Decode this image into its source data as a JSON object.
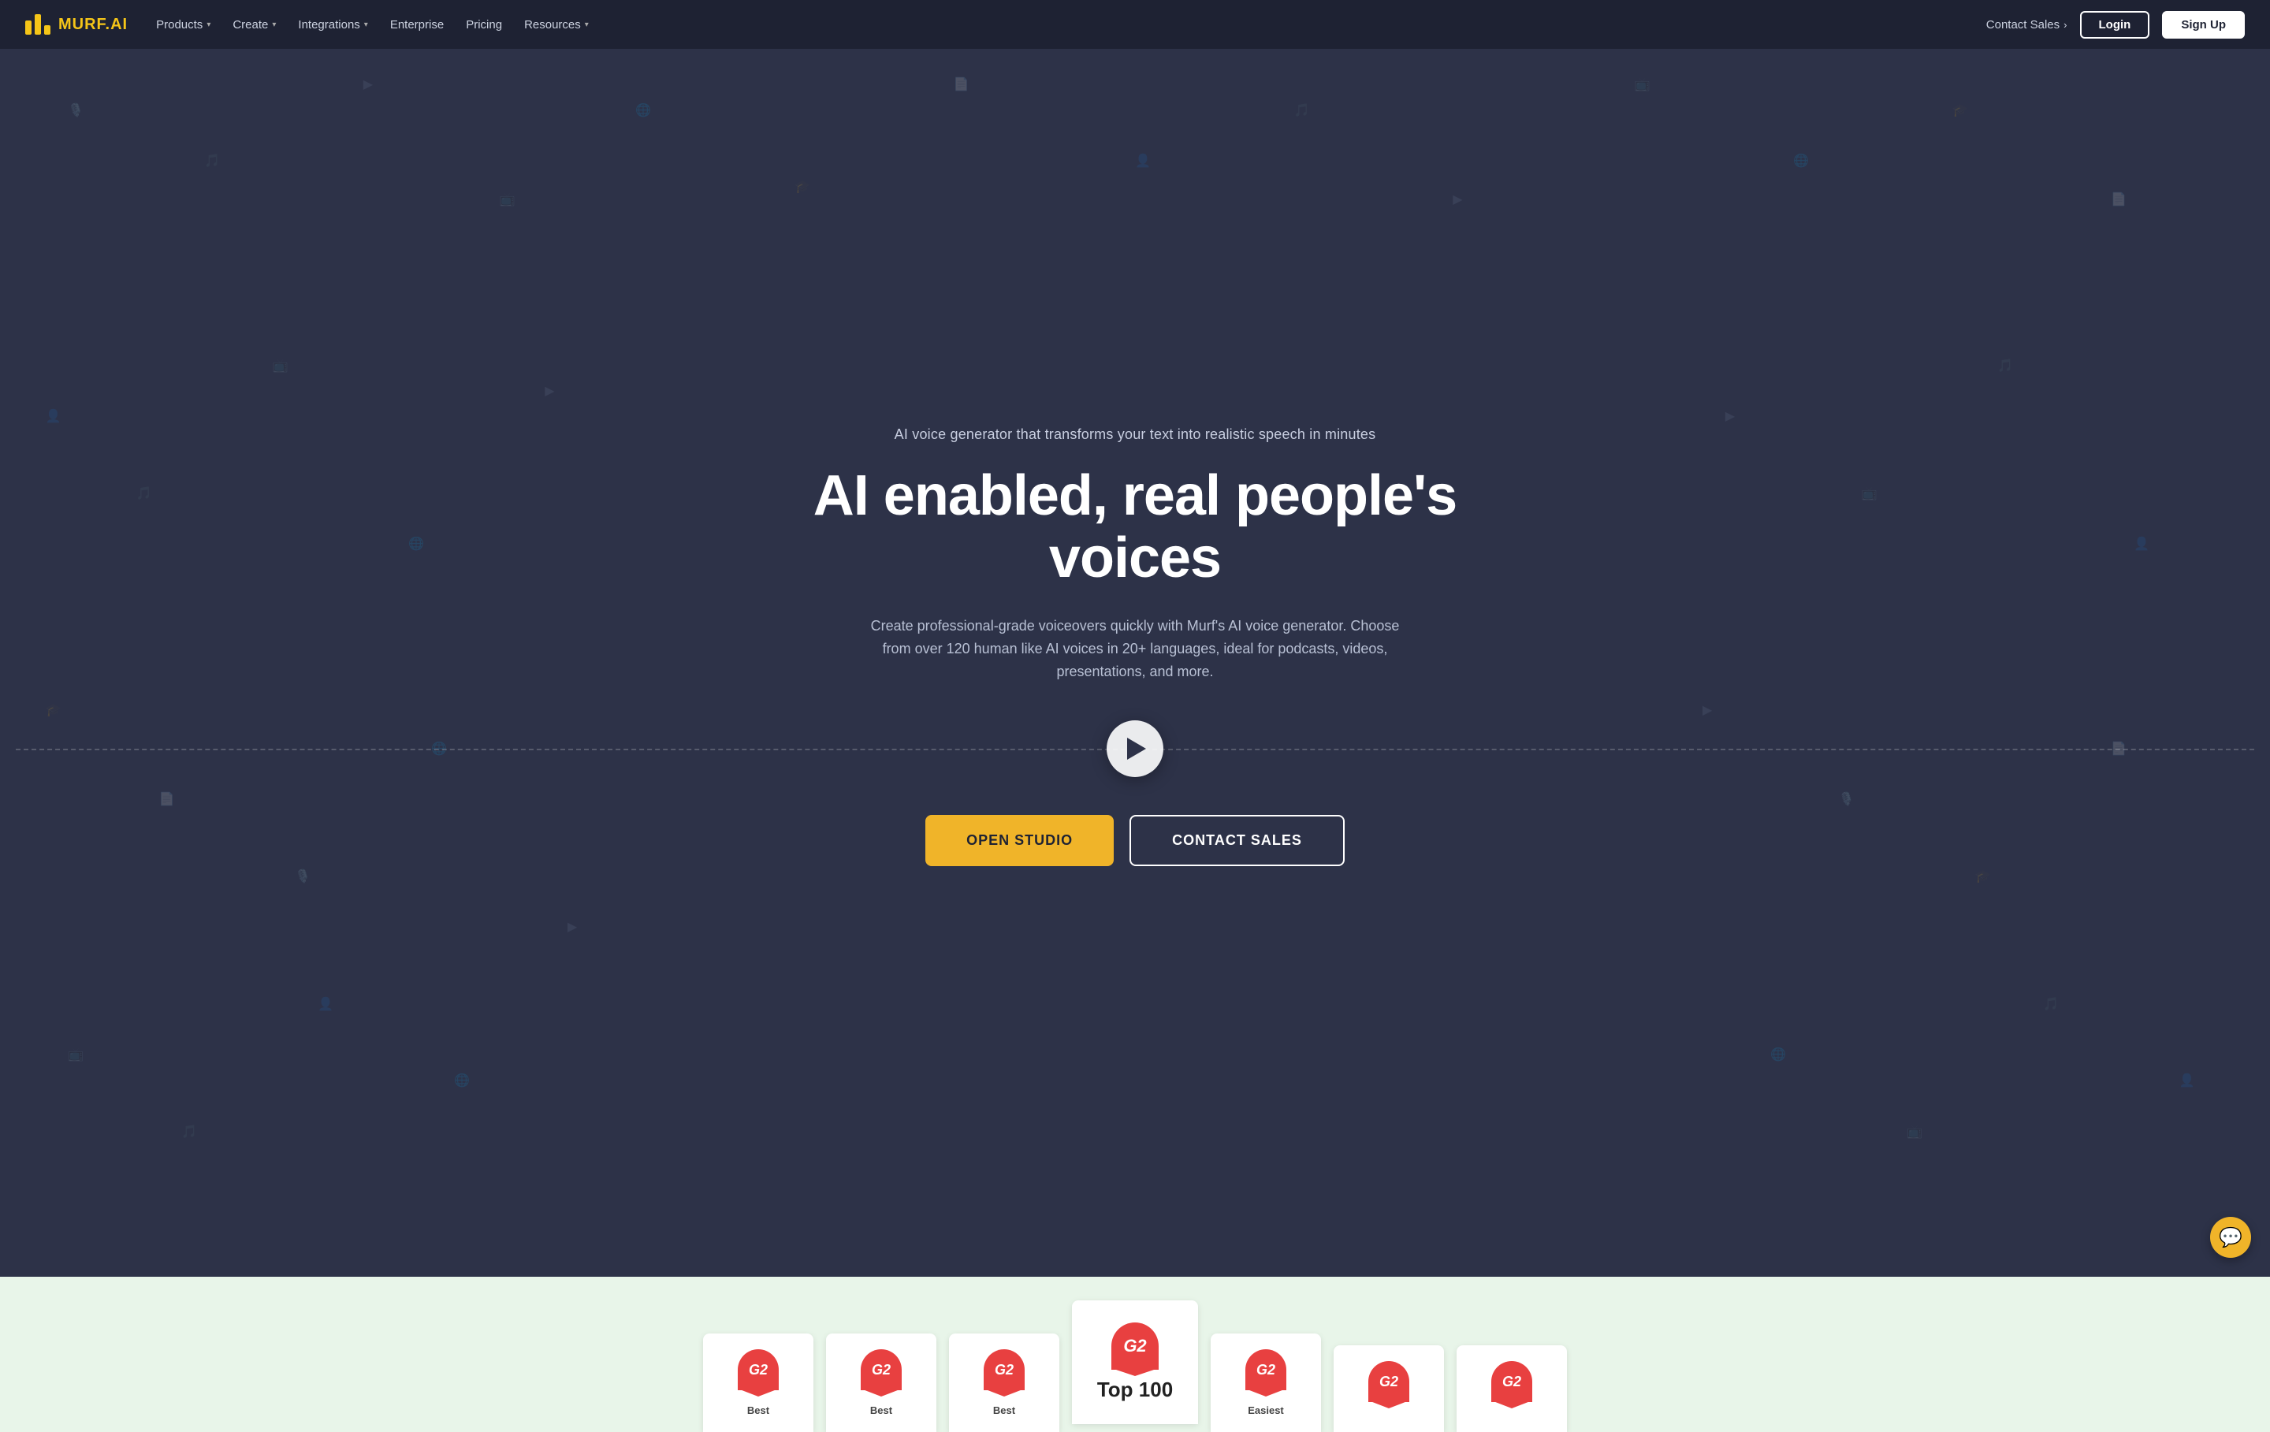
{
  "brand": {
    "name": "MURF",
    "suffix": ".AI",
    "tagline_prefix": "AI voice generator that transforms your text into realistic speech in minutes",
    "hero_title": "AI enabled, real people's voices",
    "hero_description": "Create professional-grade voiceovers quickly with Murf's AI voice generator. Choose from over 120 human like AI voices in 20+ languages, ideal for podcasts, videos, presentations, and more."
  },
  "navbar": {
    "products_label": "Products",
    "create_label": "Create",
    "integrations_label": "Integrations",
    "enterprise_label": "Enterprise",
    "pricing_label": "Pricing",
    "resources_label": "Resources",
    "contact_sales_label": "Contact Sales",
    "login_label": "Login",
    "signup_label": "Sign Up"
  },
  "cta": {
    "open_studio": "OPEN STUDIO",
    "contact_sales": "CONTACT SALES"
  },
  "awards": [
    {
      "label": "Best",
      "size": "normal"
    },
    {
      "label": "Best",
      "size": "normal"
    },
    {
      "label": "Best",
      "size": "normal"
    },
    {
      "label": "Top 100",
      "size": "featured"
    },
    {
      "label": "Easiest",
      "size": "normal"
    },
    {
      "label": "",
      "size": "normal"
    },
    {
      "label": "",
      "size": "normal"
    }
  ]
}
